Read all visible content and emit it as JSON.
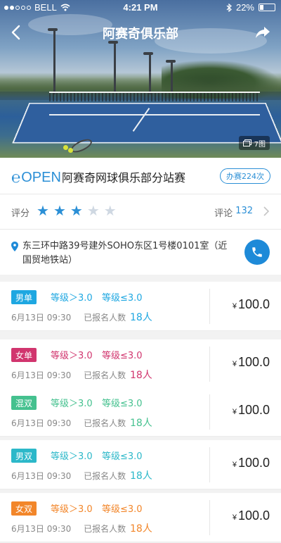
{
  "status_bar": {
    "carrier": "BELL",
    "time": "4:21 PM",
    "battery": "22%"
  },
  "nav": {
    "title": "阿赛奇俱乐部"
  },
  "hero": {
    "photo_count": "7图"
  },
  "club": {
    "logo_text": "OPEN",
    "name": "阿赛奇网球俱乐部分站赛",
    "hosted_badge": "办赛224次"
  },
  "rating": {
    "label": "评分",
    "stars": 3,
    "max_stars": 5,
    "reviews_label": "评论",
    "reviews_count": "132"
  },
  "address": {
    "text": "东三环中路39号建外SOHO东区1号楼0101室（近国贸地铁站）"
  },
  "events": [
    {
      "tag": "男单",
      "tag_color": "#1ea7e1",
      "level_gt": "等级＞3.0",
      "level_le": "等级≤3.0",
      "level_color": "#1ea7e1",
      "date": "6月13日 09:30",
      "enrolled_label": "已报名人数",
      "enrolled_count": "18人",
      "price_symbol": "¥",
      "price": "100.0"
    },
    {
      "tag": "女单",
      "tag_color": "#d1356e",
      "level_gt": "等级＞3.0",
      "level_le": "等级≤3.0",
      "level_color": "#d1356e",
      "date": "6月13日 09:30",
      "enrolled_label": "已报名人数",
      "enrolled_count": "18人",
      "price_symbol": "¥",
      "price": "100.0"
    },
    {
      "tag": "混双",
      "tag_color": "#45c18f",
      "level_gt": "等级＞3.0",
      "level_le": "等级≤3.0",
      "level_color": "#45c18f",
      "date": "6月13日 09:30",
      "enrolled_label": "已报名人数",
      "enrolled_count": "18人",
      "price_symbol": "¥",
      "price": "100.0"
    },
    {
      "tag": "男双",
      "tag_color": "#2cb8c9",
      "level_gt": "等级＞3.0",
      "level_le": "等级≤3.0",
      "level_color": "#2cb8c9",
      "date": "6月13日 09:30",
      "enrolled_label": "已报名人数",
      "enrolled_count": "18人",
      "price_symbol": "¥",
      "price": "100.0"
    },
    {
      "tag": "女双",
      "tag_color": "#f2862a",
      "level_gt": "等级＞3.0",
      "level_le": "等级≤3.0",
      "level_color": "#f2862a",
      "date": "6月13日 09:30",
      "enrolled_label": "已报名人数",
      "enrolled_count": "18人",
      "price_symbol": "¥",
      "price": "100.0"
    }
  ],
  "colors": {
    "accent": "#2b8fd6",
    "phone_button": "#1e8ad8"
  },
  "icons": {
    "back": "chevron-left-icon",
    "share": "share-arrow-icon",
    "photos": "photo-stack-icon",
    "location": "map-pin-icon",
    "phone": "phone-icon",
    "more": "chevron-right-icon"
  }
}
